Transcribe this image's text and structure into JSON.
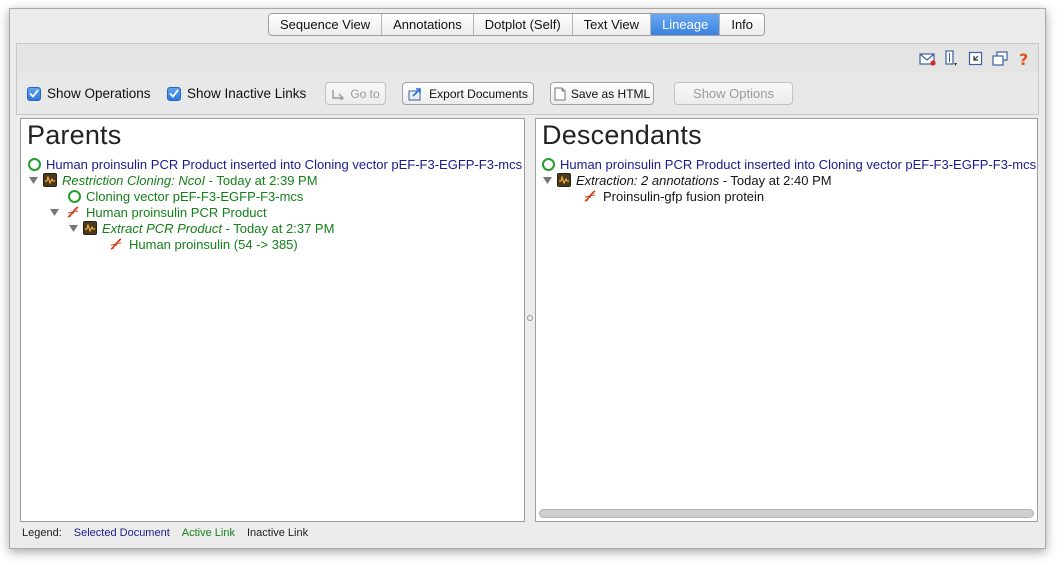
{
  "tabs": [
    {
      "label": "Sequence View",
      "active": false
    },
    {
      "label": "Annotations",
      "active": false
    },
    {
      "label": "Dotplot (Self)",
      "active": false
    },
    {
      "label": "Text View",
      "active": false
    },
    {
      "label": "Lineage",
      "active": true
    },
    {
      "label": "Info",
      "active": false
    }
  ],
  "header_icons": [
    "email-icon",
    "split-view-icon",
    "collapse-icon",
    "new-window-icon",
    "help-icon"
  ],
  "toolbar": {
    "show_operations": {
      "label": "Show Operations",
      "checked": true
    },
    "show_inactive_links": {
      "label": "Show Inactive Links",
      "checked": true
    },
    "go_to_label": "Go to",
    "export_label": "Export Documents",
    "save_html_label": "Save as HTML",
    "show_options_label": "Show Options"
  },
  "parents": {
    "title": "Parents",
    "root": "Human proinsulin PCR Product inserted into Cloning vector pEF-F3-EGFP-F3-mcs",
    "op1_name": "Restriction Cloning: NcoI",
    "op1_time": " - Today at 2:39 PM",
    "child1": "Cloning vector pEF-F3-EGFP-F3-mcs",
    "child2": "Human proinsulin PCR Product",
    "op2_name": "Extract PCR Product",
    "op2_time": " - Today at 2:37 PM",
    "leaf": "Human proinsulin (54 -> 385)"
  },
  "descendants": {
    "title": "Descendants",
    "root": "Human proinsulin PCR Product inserted into Cloning vector pEF-F3-EGFP-F3-mcs",
    "op_name": "Extraction: 2 annotations",
    "op_time": " - Today at 2:40 PM",
    "leaf": "Proinsulin-gfp fusion protein"
  },
  "legend": {
    "label": "Legend:",
    "selected": "Selected Document",
    "active": "Active Link",
    "inactive": "Inactive Link"
  },
  "colors": {
    "selected": "#1b1b8c",
    "active": "#15801a",
    "inactive": "#151515",
    "tab_active": "#3a82e0"
  }
}
